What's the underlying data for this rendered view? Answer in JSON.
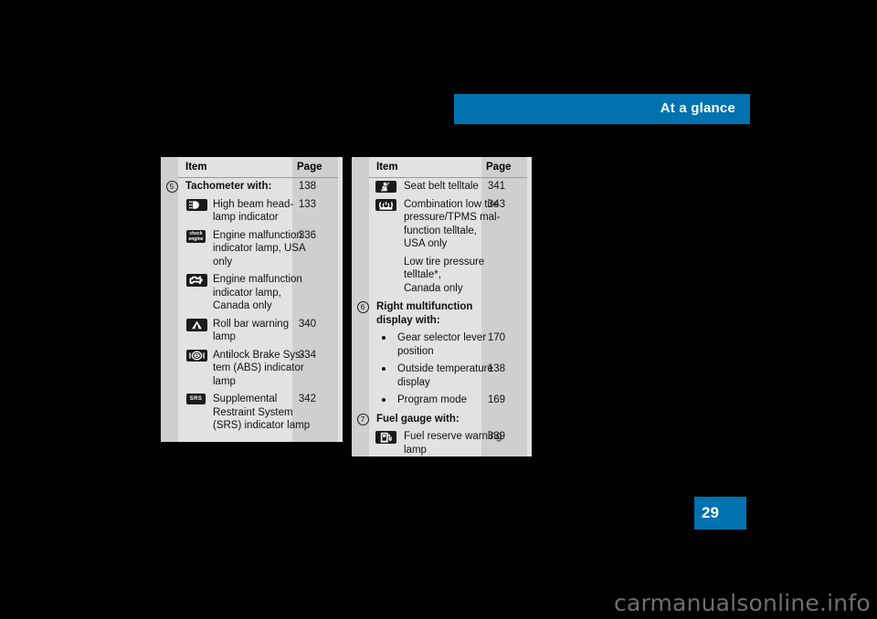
{
  "header": {
    "title": "At a glance",
    "banner_color": "#0072b0"
  },
  "page_tab": {
    "number": "29",
    "color": "#0072b0"
  },
  "watermark": {
    "text": "carmanualsonline.info"
  },
  "tables": [
    {
      "id": "table-left",
      "columns": {
        "item": "Item",
        "page": "Page"
      },
      "rows": [
        {
          "num": "5",
          "text": "Tachometer with:",
          "page": "138",
          "style": "head"
        },
        {
          "icon": "high-beam-headlamp-icon",
          "text": "High beam head-\nlamp indicator",
          "page": "133",
          "style": "icon"
        },
        {
          "icon": "check-engine-icon",
          "text": "Engine malfunction\nindicator lamp, USA\nonly",
          "page": "336",
          "style": "icon"
        },
        {
          "icon": "engine-outline-icon",
          "text": "Engine malfunction\nindicator lamp,\nCanada only",
          "page": "",
          "style": "icon"
        },
        {
          "icon": "roll-bar-warning-icon",
          "text": "Roll bar warning\nlamp",
          "page": "340",
          "style": "icon"
        },
        {
          "icon": "abs-icon",
          "text": "Antilock Brake Sys-\ntem (ABS) indicator\nlamp",
          "page": "334",
          "style": "icon"
        },
        {
          "icon": "srs-icon",
          "text": "Supplemental\nRestraint System\n(SRS) indicator lamp",
          "page": "342",
          "style": "icon"
        }
      ]
    },
    {
      "id": "table-right",
      "columns": {
        "item": "Item",
        "page": "Page"
      },
      "rows": [
        {
          "icon": "seat-belt-telltale-icon",
          "text": "Seat belt telltale",
          "page": "341",
          "style": "icon"
        },
        {
          "icon": "tire-pressure-icon",
          "text": "Combination low tire\npressure/TPMS mal-\nfunction telltale,\nUSA only",
          "page": "343",
          "style": "icon"
        },
        {
          "text": "Low tire pressure\ntelltale*,\nCanada only",
          "page": "",
          "style": "plain"
        },
        {
          "num": "6",
          "text": "Right multifunction\ndisplay with:",
          "page": "",
          "style": "head"
        },
        {
          "bullet": true,
          "text": "Gear selector lever\nposition",
          "page": "170",
          "style": "bullet"
        },
        {
          "bullet": true,
          "text": "Outside temperature\ndisplay",
          "page": "138",
          "style": "bullet"
        },
        {
          "bullet": true,
          "text": "Program mode",
          "page": "169",
          "style": "bullet"
        },
        {
          "num": "7",
          "text": "Fuel gauge with:",
          "page": "",
          "style": "head"
        },
        {
          "icon": "fuel-reserve-icon",
          "text": "Fuel reserve warning\nlamp",
          "page": "339",
          "style": "icon"
        }
      ]
    }
  ]
}
